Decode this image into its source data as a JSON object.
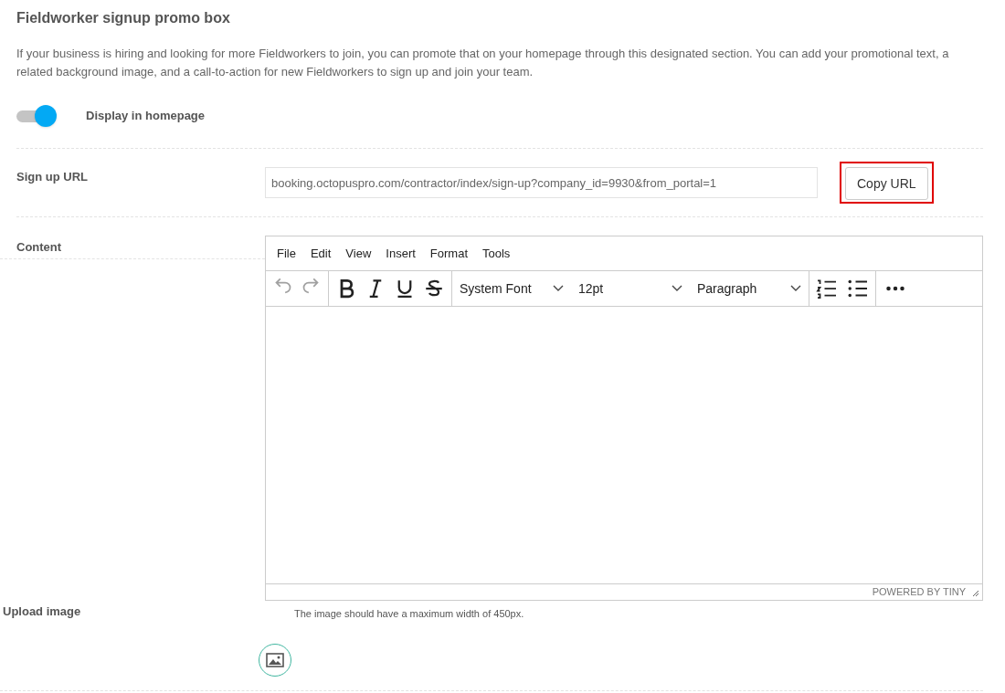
{
  "section": {
    "title": "Fieldworker signup promo box",
    "description": "If your business is hiring and looking for more Fieldworkers to join, you can promote that on your homepage through this designated section. You can add your promotional text, a related background image, and a call-to-action for new Fieldworkers to sign up and join your team."
  },
  "display_toggle": {
    "label": "Display in homepage",
    "on": true
  },
  "signup_url": {
    "label": "Sign up URL",
    "value": "booking.octopuspro.com/contractor/index/sign-up?company_id=9930&from_portal=1",
    "copy_button": "Copy URL",
    "highlighted": true
  },
  "content": {
    "label": "Content",
    "menu": [
      "File",
      "Edit",
      "View",
      "Insert",
      "Format",
      "Tools"
    ],
    "history_buttons": [
      {
        "disabled": true
      },
      {
        "disabled": true
      }
    ],
    "dropdowns": [
      {
        "label": "System Font"
      },
      {
        "label": "12pt"
      },
      {
        "label": "Paragraph"
      }
    ],
    "branding": "POWERED BY TINY"
  },
  "upload_image": {
    "label": "Upload image",
    "hint": "The image should have a maximum width of 450px."
  }
}
